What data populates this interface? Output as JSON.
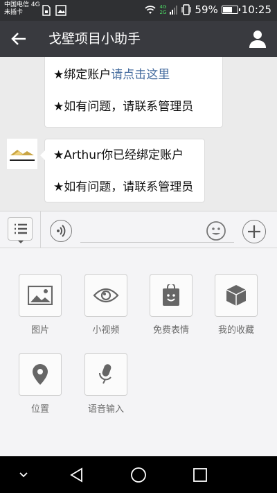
{
  "status_bar": {
    "carrier_line1": "中国电信 4G",
    "carrier_line2": "未插卡",
    "net_top": "4G",
    "net_bottom": "2G",
    "battery_percent": "59%",
    "battery_level": 0.59,
    "time": "10:25"
  },
  "header": {
    "title": "戈壁项目小助手",
    "back_icon": "arrow-left-icon",
    "profile_icon": "person-icon"
  },
  "messages": [
    {
      "lines": [
        {
          "prefix": "★绑定账户",
          "link": "请点击这里"
        },
        {
          "prefix": "★如有问题，请联系管理员",
          "link": ""
        }
      ]
    },
    {
      "lines": [
        {
          "prefix": "★Arthur你已经绑定账户",
          "link": ""
        },
        {
          "prefix": "★如有问题，请联系管理员",
          "link": ""
        }
      ]
    }
  ],
  "input_bar": {
    "menu_icon": "list-menu-icon",
    "voice_icon": "voice-icon",
    "emoji_icon": "emoji-icon",
    "plus_icon": "plus-icon"
  },
  "tools": [
    {
      "label": "图片",
      "icon": "image-icon"
    },
    {
      "label": "小视频",
      "icon": "eye-icon"
    },
    {
      "label": "免费表情",
      "icon": "sticker-bag-icon"
    },
    {
      "label": "我的收藏",
      "icon": "cube-icon"
    },
    {
      "label": "位置",
      "icon": "location-pin-icon"
    },
    {
      "label": "语音输入",
      "icon": "microphone-icon"
    }
  ],
  "nav_bar": {
    "down_icon": "chevron-down-icon",
    "back_icon": "triangle-back-icon",
    "home_icon": "circle-home-icon",
    "recent_icon": "square-recent-icon"
  }
}
